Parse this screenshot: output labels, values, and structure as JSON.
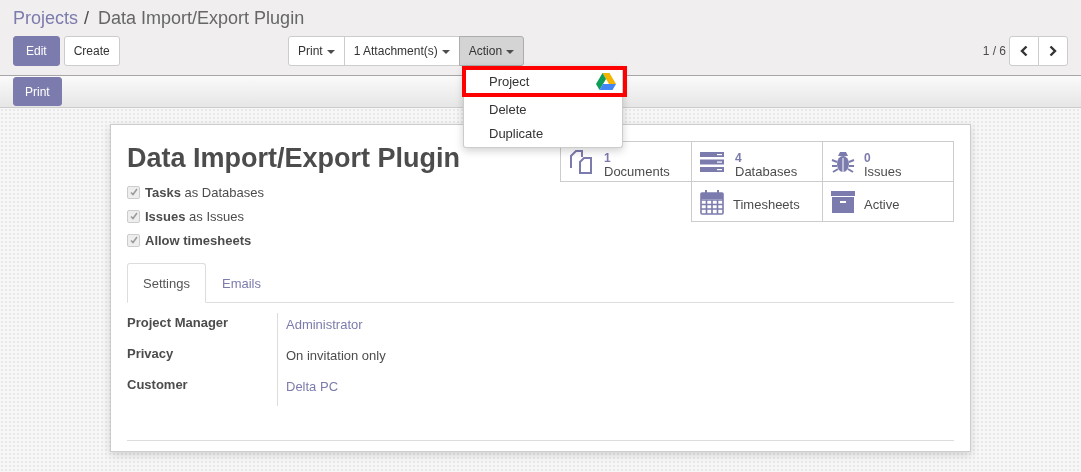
{
  "breadcrumb": {
    "parent": "Projects",
    "separator": "/",
    "current": "Data Import/Export Plugin"
  },
  "buttons": [
    {
      "label": "Edit",
      "kind": "primary"
    },
    {
      "label": "Create",
      "kind": "default"
    }
  ],
  "dropdown_buttons": [
    {
      "label": "Print",
      "open": false
    },
    {
      "label": "1 Attachment(s)",
      "open": false
    },
    {
      "label": "Action",
      "open": true
    }
  ],
  "pager": {
    "text": "1 / 6"
  },
  "subbar_buttons": [
    "Print"
  ],
  "action_menu": {
    "items": [
      {
        "label": "Project",
        "kind": "drive",
        "highlighted": true
      },
      {
        "label": "Delete",
        "kind": "plain",
        "highlighted": false
      },
      {
        "label": "Duplicate",
        "kind": "plain",
        "highlighted": false
      }
    ]
  },
  "record": {
    "title": "Data Import/Export Plugin",
    "options": [
      {
        "label": "Tasks",
        "suffix": "as Databases",
        "checked": true
      },
      {
        "label": "Issues",
        "suffix": "as Issues",
        "checked": true
      },
      {
        "label": "Allow timesheets",
        "checked": true
      }
    ],
    "stat_buttons": [
      {
        "count": "1",
        "label": "Documents",
        "kind": "documents"
      },
      {
        "count": "4",
        "label": "Databases",
        "kind": "databases"
      },
      {
        "count": "0",
        "label": "Issues",
        "kind": "issues"
      },
      {
        "label": "Timesheets",
        "kind": "timesheets"
      },
      {
        "label": "Active",
        "kind": "archive"
      }
    ],
    "tabs": [
      {
        "label": "Settings",
        "selected": true
      },
      {
        "label": "Emails",
        "selected": false
      }
    ],
    "fields": [
      {
        "label": "Project Manager",
        "value": "Administrator",
        "kind": "link"
      },
      {
        "label": "Privacy",
        "value": "On invitation only",
        "kind": "text"
      },
      {
        "label": "Customer",
        "value": "Delta PC",
        "kind": "link"
      }
    ]
  }
}
